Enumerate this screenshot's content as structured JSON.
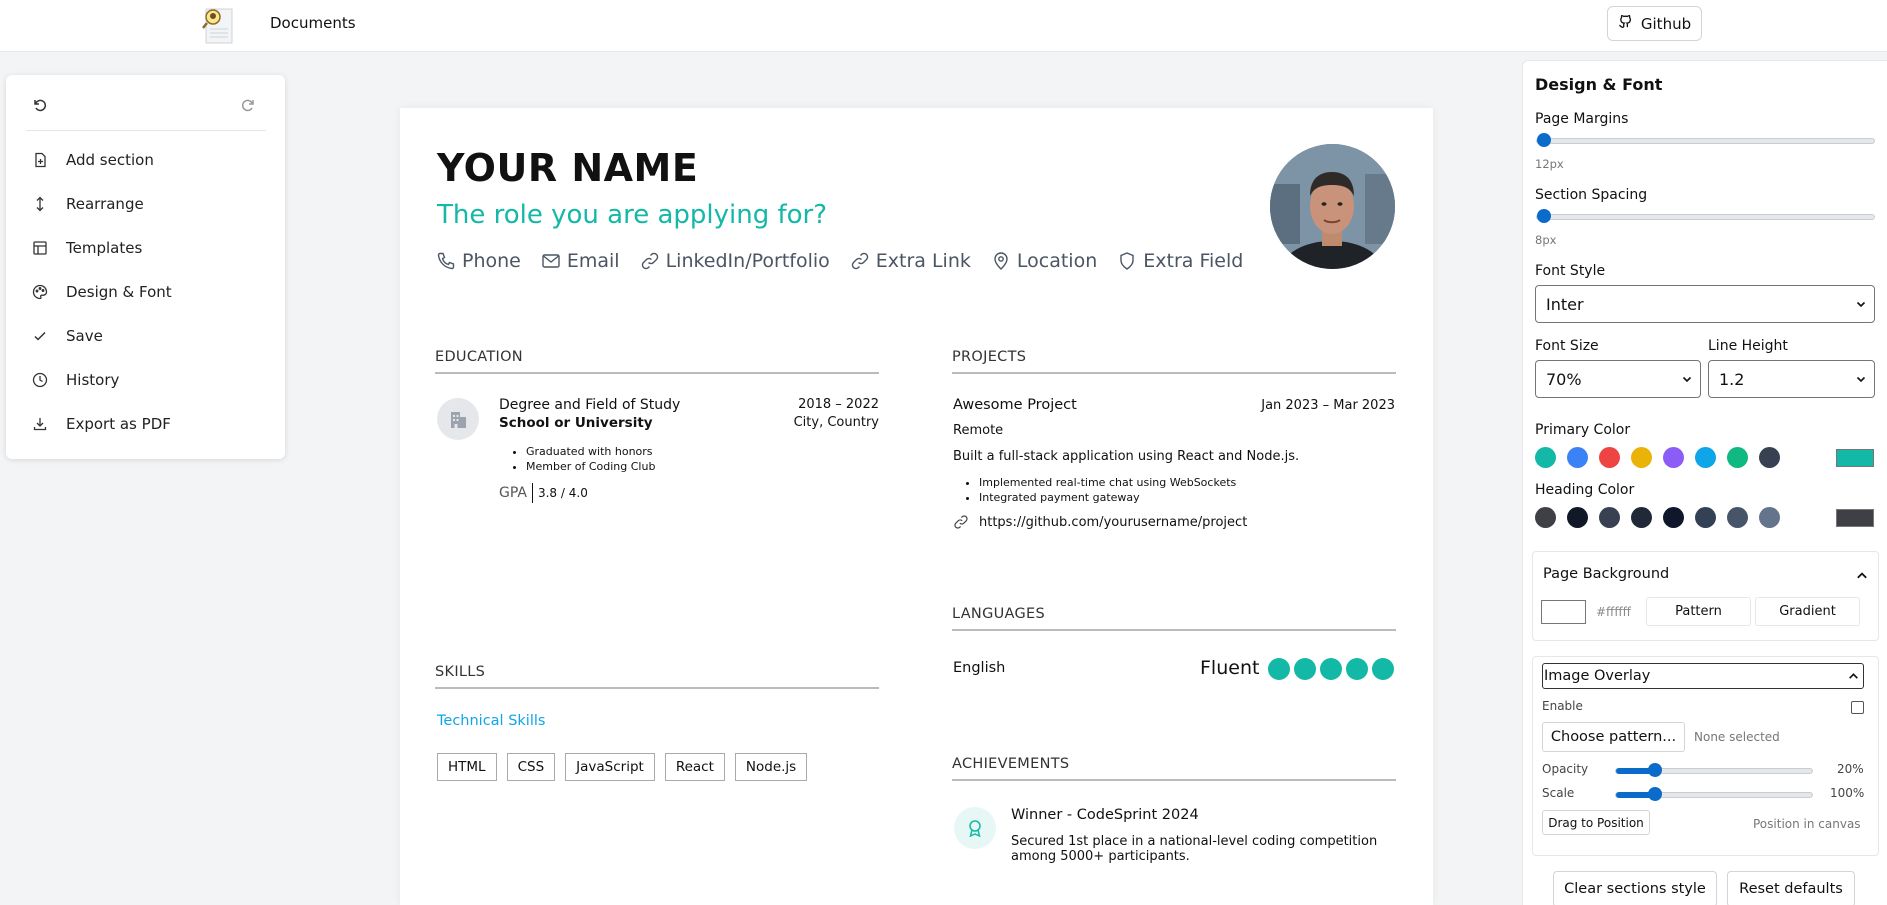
{
  "header": {
    "brand": "Documents",
    "github_label": "Github"
  },
  "sidebar": {
    "items": [
      {
        "label": "Add section",
        "icon": "file-plus-icon"
      },
      {
        "label": "Rearrange",
        "icon": "arrows-vertical-icon"
      },
      {
        "label": "Templates",
        "icon": "layout-icon"
      },
      {
        "label": "Design & Font",
        "icon": "palette-icon"
      },
      {
        "label": "Save",
        "icon": "check-icon"
      },
      {
        "label": "History",
        "icon": "clock-icon"
      },
      {
        "label": "Export as PDF",
        "icon": "download-icon"
      }
    ]
  },
  "resume": {
    "name": "YOUR NAME",
    "role": "The role you are applying for?",
    "contacts": [
      "Phone",
      "Email",
      "LinkedIn/Portfolio",
      "Extra Link",
      "Location",
      "Extra Field"
    ],
    "education": {
      "heading": "EDUCATION",
      "degree": "Degree and Field of Study",
      "school": "School or University",
      "years": "2018 – 2022",
      "location": "City, Country",
      "bullets": [
        "Graduated with honors",
        "Member of Coding Club"
      ],
      "gpa_label": "GPA",
      "gpa_value": "3.8 / 4.0"
    },
    "skills": {
      "heading": "SKILLS",
      "category": "Technical Skills",
      "tags": [
        "HTML",
        "CSS",
        "JavaScript",
        "React",
        "Node.js"
      ]
    },
    "projects": {
      "heading": "PROJECTS",
      "title": "Awesome Project",
      "dates": "Jan 2023 – Mar 2023",
      "location": "Remote",
      "description": "Built a full-stack application using React and Node.js.",
      "bullets": [
        "Implemented real-time chat using WebSockets",
        "Integrated payment gateway"
      ],
      "link": "https://github.com/yourusername/project"
    },
    "languages": {
      "heading": "LANGUAGES",
      "name": "English",
      "level": "Fluent",
      "rating": 5
    },
    "achievements": {
      "heading": "ACHIEVEMENTS",
      "title": "Winner - CodeSprint 2024",
      "description": "Secured 1st place in a national-level coding competition among 5000+ participants."
    }
  },
  "design_panel": {
    "title": "Design & Font",
    "page_margins_label": "Page Margins",
    "page_margins_value": "12px",
    "section_spacing_label": "Section Spacing",
    "section_spacing_value": "8px",
    "font_style_label": "Font Style",
    "font_style_value": "Inter",
    "font_size_label": "Font Size",
    "font_size_value": "70%",
    "line_height_label": "Line Height",
    "line_height_value": "1.2",
    "primary_color_label": "Primary Color",
    "primary_colors": [
      "#14b8a6",
      "#3b82f6",
      "#ef4444",
      "#eab308",
      "#8b5cf6",
      "#0ea5e9",
      "#10b981",
      "#374151"
    ],
    "primary_selected": "#14b8a6",
    "heading_color_label": "Heading Color",
    "heading_colors": [
      "#3f3f46",
      "#111827",
      "#374151",
      "#1f2937",
      "#0f172a",
      "#334155",
      "#475569",
      "#64748b"
    ],
    "heading_selected": "#3f3f46",
    "page_background": {
      "title": "Page Background",
      "color_value": "#ffffff",
      "pattern_label": "Pattern",
      "gradient_label": "Gradient"
    },
    "image_overlay": {
      "title": "Image Overlay",
      "enable_label": "Enable",
      "enabled": false,
      "choose_label": "Choose pattern...",
      "selection_status": "None selected",
      "opacity_label": "Opacity",
      "opacity_value": "20%",
      "scale_label": "Scale",
      "scale_value": "100%",
      "drag_label": "Drag to Position",
      "position_hint": "Position in canvas"
    },
    "clear_label": "Clear sections style",
    "reset_label": "Reset defaults"
  }
}
